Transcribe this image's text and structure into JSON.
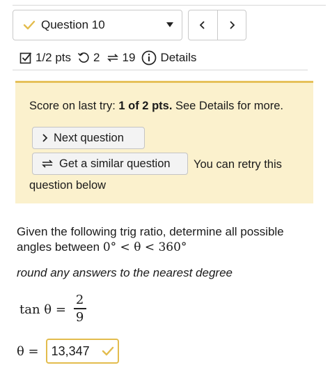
{
  "question_nav": {
    "question_label": "Question 10",
    "prev_glyph": "‹",
    "next_glyph": "›"
  },
  "meta": {
    "points": "1/2 pts",
    "attempts_left": "2",
    "similar_count": "19",
    "details": "Details"
  },
  "banner": {
    "score_prefix": "Score on last try: ",
    "score_value": "1 of 2 pts.",
    "score_suffix": " See Details for more.",
    "next_question": "Next question",
    "similar_question": "Get a similar question",
    "retry_line1": "You can retry this",
    "retry_line2": "question below"
  },
  "problem": {
    "prompt_line1": "Given the following trig ratio, determine all possible",
    "prompt_line2_text": "angles between ",
    "prompt_math": "0° < θ < 360°",
    "instruction": "round any answers to the nearest degree",
    "ratio_lhs": "tan θ =",
    "ratio_num": "2",
    "ratio_den": "9",
    "answer_lhs": "θ =",
    "answer_value": "13,347"
  },
  "colors": {
    "banner_bg": "#fbf1cd",
    "banner_border": "#e6c15a",
    "check": "#e3bc4d"
  },
  "icons": [
    "check-icon",
    "chevron-left-icon",
    "chevron-right-icon",
    "checkbox-icon",
    "retry-icon",
    "similar-icon",
    "info-icon",
    "chevron-right-icon"
  ]
}
